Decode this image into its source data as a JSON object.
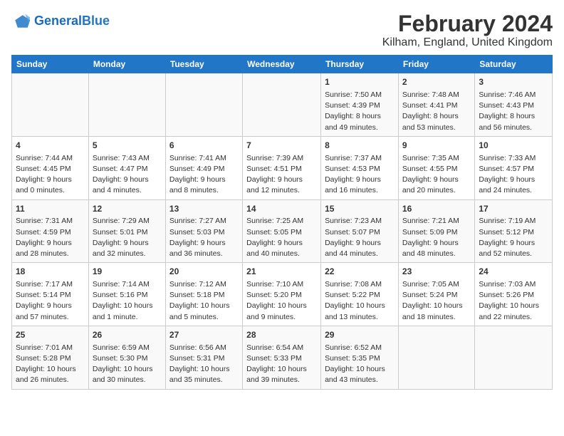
{
  "header": {
    "logo_line1": "General",
    "logo_line2": "Blue",
    "title": "February 2024",
    "subtitle": "Kilham, England, United Kingdom"
  },
  "weekdays": [
    "Sunday",
    "Monday",
    "Tuesday",
    "Wednesday",
    "Thursday",
    "Friday",
    "Saturday"
  ],
  "weeks": [
    [
      {
        "num": "",
        "info": ""
      },
      {
        "num": "",
        "info": ""
      },
      {
        "num": "",
        "info": ""
      },
      {
        "num": "",
        "info": ""
      },
      {
        "num": "1",
        "info": "Sunrise: 7:50 AM\nSunset: 4:39 PM\nDaylight: 8 hours\nand 49 minutes."
      },
      {
        "num": "2",
        "info": "Sunrise: 7:48 AM\nSunset: 4:41 PM\nDaylight: 8 hours\nand 53 minutes."
      },
      {
        "num": "3",
        "info": "Sunrise: 7:46 AM\nSunset: 4:43 PM\nDaylight: 8 hours\nand 56 minutes."
      }
    ],
    [
      {
        "num": "4",
        "info": "Sunrise: 7:44 AM\nSunset: 4:45 PM\nDaylight: 9 hours\nand 0 minutes."
      },
      {
        "num": "5",
        "info": "Sunrise: 7:43 AM\nSunset: 4:47 PM\nDaylight: 9 hours\nand 4 minutes."
      },
      {
        "num": "6",
        "info": "Sunrise: 7:41 AM\nSunset: 4:49 PM\nDaylight: 9 hours\nand 8 minutes."
      },
      {
        "num": "7",
        "info": "Sunrise: 7:39 AM\nSunset: 4:51 PM\nDaylight: 9 hours\nand 12 minutes."
      },
      {
        "num": "8",
        "info": "Sunrise: 7:37 AM\nSunset: 4:53 PM\nDaylight: 9 hours\nand 16 minutes."
      },
      {
        "num": "9",
        "info": "Sunrise: 7:35 AM\nSunset: 4:55 PM\nDaylight: 9 hours\nand 20 minutes."
      },
      {
        "num": "10",
        "info": "Sunrise: 7:33 AM\nSunset: 4:57 PM\nDaylight: 9 hours\nand 24 minutes."
      }
    ],
    [
      {
        "num": "11",
        "info": "Sunrise: 7:31 AM\nSunset: 4:59 PM\nDaylight: 9 hours\nand 28 minutes."
      },
      {
        "num": "12",
        "info": "Sunrise: 7:29 AM\nSunset: 5:01 PM\nDaylight: 9 hours\nand 32 minutes."
      },
      {
        "num": "13",
        "info": "Sunrise: 7:27 AM\nSunset: 5:03 PM\nDaylight: 9 hours\nand 36 minutes."
      },
      {
        "num": "14",
        "info": "Sunrise: 7:25 AM\nSunset: 5:05 PM\nDaylight: 9 hours\nand 40 minutes."
      },
      {
        "num": "15",
        "info": "Sunrise: 7:23 AM\nSunset: 5:07 PM\nDaylight: 9 hours\nand 44 minutes."
      },
      {
        "num": "16",
        "info": "Sunrise: 7:21 AM\nSunset: 5:09 PM\nDaylight: 9 hours\nand 48 minutes."
      },
      {
        "num": "17",
        "info": "Sunrise: 7:19 AM\nSunset: 5:12 PM\nDaylight: 9 hours\nand 52 minutes."
      }
    ],
    [
      {
        "num": "18",
        "info": "Sunrise: 7:17 AM\nSunset: 5:14 PM\nDaylight: 9 hours\nand 57 minutes."
      },
      {
        "num": "19",
        "info": "Sunrise: 7:14 AM\nSunset: 5:16 PM\nDaylight: 10 hours\nand 1 minute."
      },
      {
        "num": "20",
        "info": "Sunrise: 7:12 AM\nSunset: 5:18 PM\nDaylight: 10 hours\nand 5 minutes."
      },
      {
        "num": "21",
        "info": "Sunrise: 7:10 AM\nSunset: 5:20 PM\nDaylight: 10 hours\nand 9 minutes."
      },
      {
        "num": "22",
        "info": "Sunrise: 7:08 AM\nSunset: 5:22 PM\nDaylight: 10 hours\nand 13 minutes."
      },
      {
        "num": "23",
        "info": "Sunrise: 7:05 AM\nSunset: 5:24 PM\nDaylight: 10 hours\nand 18 minutes."
      },
      {
        "num": "24",
        "info": "Sunrise: 7:03 AM\nSunset: 5:26 PM\nDaylight: 10 hours\nand 22 minutes."
      }
    ],
    [
      {
        "num": "25",
        "info": "Sunrise: 7:01 AM\nSunset: 5:28 PM\nDaylight: 10 hours\nand 26 minutes."
      },
      {
        "num": "26",
        "info": "Sunrise: 6:59 AM\nSunset: 5:30 PM\nDaylight: 10 hours\nand 30 minutes."
      },
      {
        "num": "27",
        "info": "Sunrise: 6:56 AM\nSunset: 5:31 PM\nDaylight: 10 hours\nand 35 minutes."
      },
      {
        "num": "28",
        "info": "Sunrise: 6:54 AM\nSunset: 5:33 PM\nDaylight: 10 hours\nand 39 minutes."
      },
      {
        "num": "29",
        "info": "Sunrise: 6:52 AM\nSunset: 5:35 PM\nDaylight: 10 hours\nand 43 minutes."
      },
      {
        "num": "",
        "info": ""
      },
      {
        "num": "",
        "info": ""
      }
    ]
  ]
}
